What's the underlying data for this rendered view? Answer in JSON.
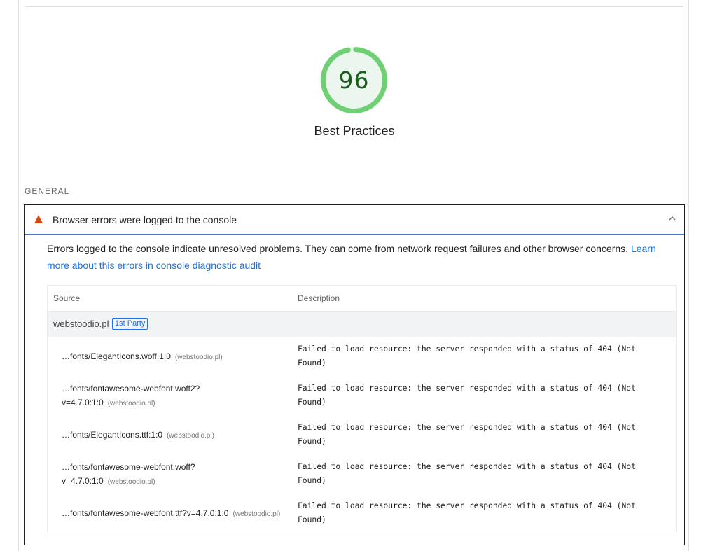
{
  "score": {
    "value": "96",
    "fraction": 0.96,
    "label": "Best Practices",
    "color": "#0cce6b"
  },
  "group": {
    "title": "GENERAL"
  },
  "audit": {
    "title": "Browser errors were logged to the console",
    "status_icon": "fail-triangle-icon",
    "description": "Errors logged to the console indicate unresolved problems. They can come from network request failures and other browser concerns. ",
    "learn_more": "Learn more about this errors in console diagnostic audit",
    "table": {
      "headers": {
        "source": "Source",
        "description": "Description"
      },
      "group": {
        "name": "webstoodio.pl",
        "badge": "1st Party"
      },
      "rows": [
        {
          "source_line1": "…fonts/ElegantIcons.woff:1:0",
          "source_line2": "",
          "host": "(webstoodio.pl)",
          "message": "Failed to load resource: the server responded with a status of 404 (Not Found)"
        },
        {
          "source_line1": "…fonts/fontawesome-webfont.woff2?",
          "source_line2": "v=4.7.0:1:0",
          "host": "(webstoodio.pl)",
          "message": "Failed to load resource: the server responded with a status of 404 (Not Found)"
        },
        {
          "source_line1": "…fonts/ElegantIcons.ttf:1:0",
          "source_line2": "",
          "host": "(webstoodio.pl)",
          "message": "Failed to load resource: the server responded with a status of 404 (Not Found)"
        },
        {
          "source_line1": "…fonts/fontawesome-webfont.woff?",
          "source_line2": "v=4.7.0:1:0",
          "host": "(webstoodio.pl)",
          "message": "Failed to load resource: the server responded with a status of 404 (Not Found)"
        },
        {
          "source_line1": "…fonts/fontawesome-webfont.ttf?v=4.7.0:1:0",
          "source_line2": "",
          "host": "(webstoodio.pl)",
          "message": "Failed to load resource: the server responded with a status of 404 (Not Found)"
        }
      ]
    }
  }
}
